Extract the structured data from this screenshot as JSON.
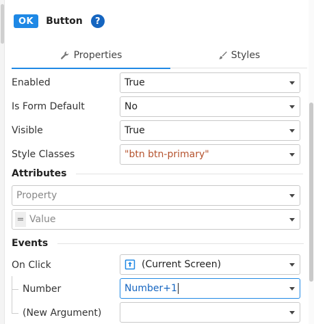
{
  "header": {
    "badge": "OK",
    "title": "Button",
    "help": "?"
  },
  "tabs": [
    {
      "label": "Properties",
      "icon": "wrench-icon",
      "active": true
    },
    {
      "label": "Styles",
      "icon": "brush-icon",
      "active": false
    }
  ],
  "properties": {
    "enabled": {
      "label": "Enabled",
      "value": "True"
    },
    "form_default": {
      "label": "Is Form Default",
      "value": "No"
    },
    "visible": {
      "label": "Visible",
      "value": "True"
    },
    "style_classes": {
      "label": "Style Classes",
      "value": "\"btn btn-primary\""
    }
  },
  "attributes": {
    "heading": "Attributes",
    "property_placeholder": "Property",
    "value_prefix": "=",
    "value_placeholder": "Value"
  },
  "events": {
    "heading": "Events",
    "on_click": {
      "label": "On Click",
      "value": "(Current Screen)",
      "icon": "screen-icon"
    },
    "number": {
      "label": "Number",
      "value": "Number+1"
    },
    "new_argument": {
      "label": "(New Argument)",
      "value": ""
    }
  },
  "colors": {
    "accent": "#1e88e5",
    "string_value": "#b5532e",
    "help_badge": "#1565c0"
  }
}
